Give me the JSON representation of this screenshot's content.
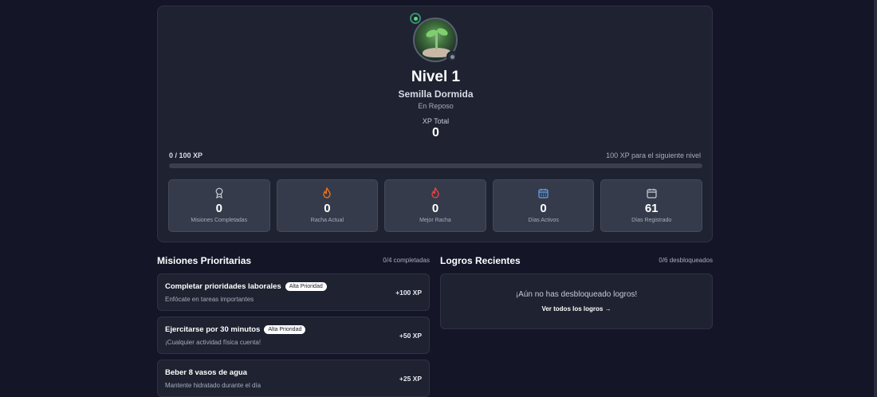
{
  "profile": {
    "level": "Nivel 1",
    "name": "Semilla Dormida",
    "state": "En Reposo",
    "xp_label": "XP Total",
    "xp_total": "0",
    "progress_text": "0 / 100 XP",
    "next_level_text": "100 XP para el siguiente nivel",
    "progress_fraction": 0
  },
  "stats": [
    {
      "icon": "award-icon",
      "value": "0",
      "label": "Misiones Completadas",
      "color": "#c8ccd6"
    },
    {
      "icon": "flame-icon",
      "value": "0",
      "label": "Racha Actual",
      "color": "#f97316"
    },
    {
      "icon": "flame-icon",
      "value": "0",
      "label": "Mejor Racha",
      "color": "#ef4444"
    },
    {
      "icon": "calendar-icon",
      "value": "0",
      "label": "Días Activos",
      "color": "#60a5fa"
    },
    {
      "icon": "calendar-icon",
      "value": "61",
      "label": "Días Registrado",
      "color": "#c8ccd6"
    }
  ],
  "missions": {
    "title": "Misiones Prioritarias",
    "meta": "0/4 completadas",
    "items": [
      {
        "title": "Completar prioridades laborales",
        "badge": "Alta Prioridad",
        "subtitle": "Enfócate en tareas importantes",
        "xp": "+100 XP"
      },
      {
        "title": "Ejercitarse por 30 minutos",
        "badge": "Alta Prioridad",
        "subtitle": "¡Cualquier actividad física cuenta!",
        "xp": "+50 XP"
      },
      {
        "title": "Beber 8 vasos de agua",
        "badge": "",
        "subtitle": "Mantente hidratado durante el día",
        "xp": "+25 XP"
      }
    ]
  },
  "achievements": {
    "title": "Logros Recientes",
    "meta": "0/6 desbloqueados",
    "empty_text": "¡Aún no has desbloqueado logros!",
    "link_text": "Ver todos los logros →"
  },
  "colors": {
    "background": "#141628",
    "card": "#1e2231",
    "stat_card": "#353b4b",
    "online": "#4ade80"
  }
}
